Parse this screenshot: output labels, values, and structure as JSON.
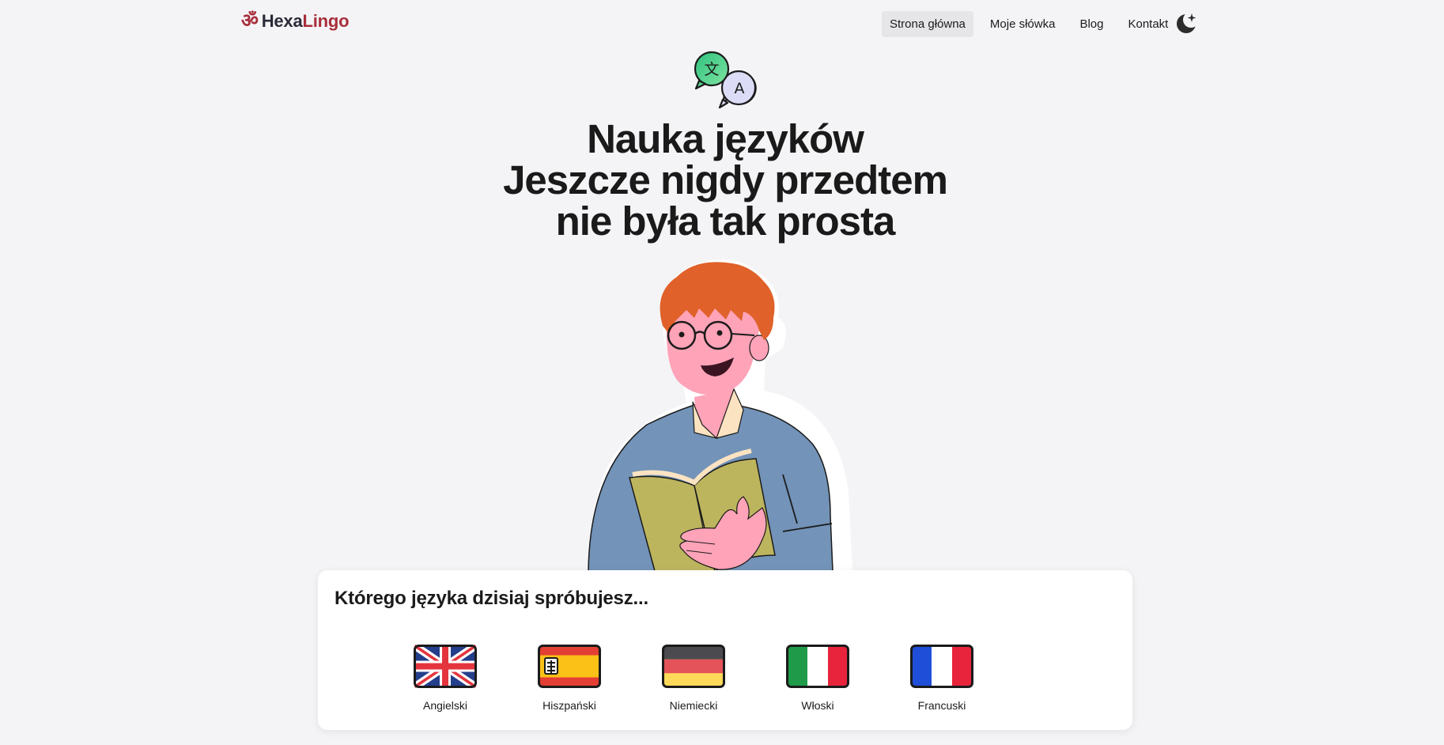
{
  "brand": {
    "prefix": "Hexa",
    "suffix": "Lingo",
    "symbol": "ॐ",
    "accent": "#a82e3b",
    "dark": "#2b2b3a"
  },
  "nav": {
    "items": [
      {
        "label": "Strona główna",
        "active": true
      },
      {
        "label": "Moje słówka",
        "active": false
      },
      {
        "label": "Blog",
        "active": false
      },
      {
        "label": "Kontakt",
        "active": false
      }
    ],
    "theme_icon": "moon-star-icon"
  },
  "hero": {
    "icon": "translate-bubbles-icon",
    "icon_glyphs": [
      "文",
      "A"
    ],
    "lines": [
      "Nauka języków",
      "Jeszcze nigdy przedtem",
      "nie była tak prosta"
    ]
  },
  "card": {
    "title": "Którego języka dzisiaj spróbujesz...",
    "languages": [
      {
        "label": "Angielski",
        "flag": "uk-flag-icon"
      },
      {
        "label": "Hiszpański",
        "flag": "spain-flag-icon"
      },
      {
        "label": "Niemiecki",
        "flag": "germany-flag-icon"
      },
      {
        "label": "Włoski",
        "flag": "italy-flag-icon"
      },
      {
        "label": "Francuski",
        "flag": "france-flag-icon"
      }
    ]
  },
  "colors": {
    "background": "#f4f4f6",
    "shirt": "#7393b8",
    "hair": "#e0612a",
    "skin": "#ffa3b8",
    "book": "#bdb55e"
  }
}
